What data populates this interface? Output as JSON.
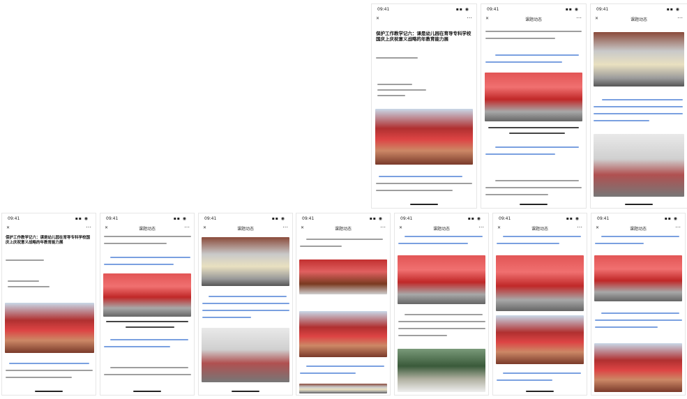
{
  "phones": [
    {
      "id": "top-1",
      "time": "09:41",
      "signal": "▪▪ ◉",
      "nav_title": "",
      "article_title": "保护工作教学记六：课是幼儿园在育导专科学校国庆上庆祝意义战略的年教育能力展"
    },
    {
      "id": "top-2",
      "time": "09:41",
      "signal": "▪▪ ◉",
      "nav_title": "课题动态"
    },
    {
      "id": "top-3",
      "time": "09:41",
      "signal": "▪▪ ◉",
      "nav_title": "课题动态"
    },
    {
      "id": "bottom-1",
      "time": "09:41",
      "signal": "▪▪ ◉",
      "nav_title": "",
      "article_title": "保护工作教学记六：课是幼儿园在育导专科学校国庆上庆祝意义战略的年教育能力展"
    },
    {
      "id": "bottom-2",
      "time": "09:41",
      "signal": "▪▪ ◉",
      "nav_title": "课题动态"
    },
    {
      "id": "bottom-3",
      "time": "09:41",
      "signal": "▪▪ ◉",
      "nav_title": "课题动态"
    },
    {
      "id": "bottom-4",
      "time": "09:41",
      "signal": "▪▪ ◉",
      "nav_title": "课题动态"
    },
    {
      "id": "bottom-5",
      "time": "09:41",
      "signal": "▪▪ ◉",
      "nav_title": "课题动态"
    },
    {
      "id": "bottom-6",
      "time": "09:41",
      "signal": "▪▪ ◉",
      "nav_title": "课题动态"
    },
    {
      "id": "bottom-7",
      "time": "09:41",
      "signal": "▪▪ ◉",
      "nav_title": "课题动态"
    }
  ],
  "icons": {
    "close": "close-icon",
    "more": "more-icon"
  }
}
